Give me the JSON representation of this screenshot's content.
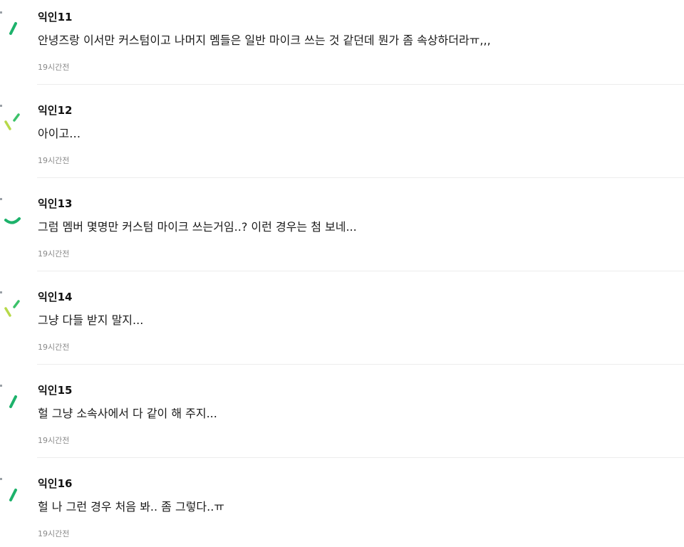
{
  "comments": [
    {
      "author": "익인11",
      "text": "안녕즈랑 이서만 커스텀이고 나머지 멤들은 일반 마이크 쓰는 것 같던데 뭔가 좀 속상하더라ㅠ,,,",
      "time": "19시간전",
      "avatar_icon": "green-stroke-icon"
    },
    {
      "author": "익인12",
      "text": "아이고…",
      "time": "19시간전",
      "avatar_icon": "lime-check-stroke-icon"
    },
    {
      "author": "익인13",
      "text": "그럼 멤버 몇명만 커스텀 마이크 쓰는거임..? 이런 경우는 첨 보네...",
      "time": "19시간전",
      "avatar_icon": "green-arc-icon"
    },
    {
      "author": "익인14",
      "text": "그냥 다들 받지 말지...",
      "time": "19시간전",
      "avatar_icon": "lime-check-stroke-icon"
    },
    {
      "author": "익인15",
      "text": "헐 그냥 소속사에서 다 같이 해 주지...",
      "time": "19시간전",
      "avatar_icon": "green-stroke-icon"
    },
    {
      "author": "익인16",
      "text": "헐 나 그런 경우 처음 봐.. 좀 그렇다..ㅠ",
      "time": "19시간전",
      "avatar_icon": "green-stroke-icon"
    }
  ],
  "colors": {
    "accent_green": "#1db26b",
    "accent_lime": "#b7d94a",
    "divider": "#ececec",
    "time_text": "#8a8a8a"
  }
}
